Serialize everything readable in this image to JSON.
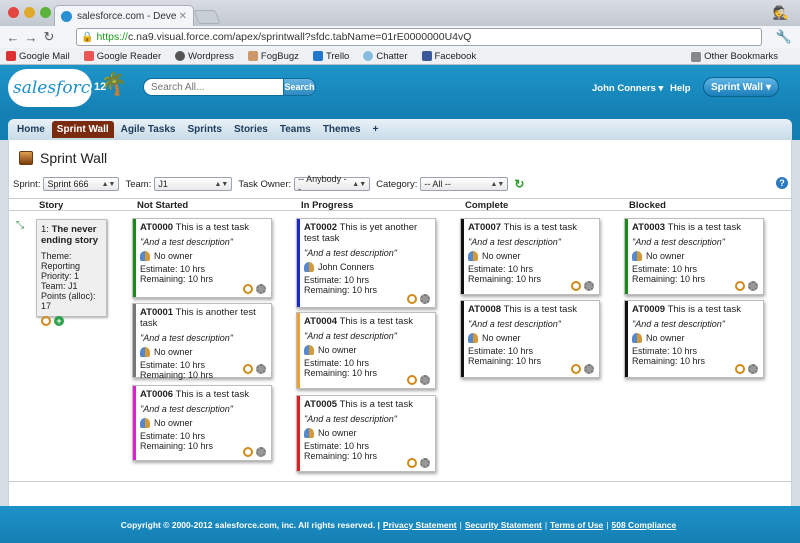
{
  "browser": {
    "tab_title": "salesforce.com - Developer E",
    "url_https": "https://",
    "url_rest": "c.na9.visual.force.com/apex/sprintwall?sfdc.tabName=01rE0000000U4vQ",
    "bookmarks": [
      "Google Mail",
      "Google Reader",
      "Wordpress",
      "FogBugz",
      "Trello",
      "Chatter",
      "Facebook"
    ],
    "other_bookmarks": "Other Bookmarks"
  },
  "header": {
    "logo_text": "salesforce",
    "logo_version": "12",
    "search_placeholder": "Search All...",
    "search_button": "Search",
    "user_name": "John Conners",
    "help": "Help",
    "app_selector": "Sprint Wall"
  },
  "nav_tabs": [
    "Home",
    "Sprint Wall",
    "Agile Tasks",
    "Sprints",
    "Stories",
    "Teams",
    "Themes",
    "+"
  ],
  "page": {
    "title": "Sprint Wall",
    "filters": {
      "sprint_label": "Sprint:",
      "sprint_value": "Sprint 666",
      "team_label": "Team:",
      "team_value": "J1",
      "owner_label": "Task Owner:",
      "owner_value": "-- Anybody --",
      "category_label": "Category:",
      "category_value": "-- All --"
    },
    "columns": [
      "Story",
      "Not Started",
      "In Progress",
      "Complete",
      "Blocked"
    ]
  },
  "story": {
    "number": "1:",
    "title": "The never ending story",
    "theme": "Theme: Reporting",
    "priority": "Priority: 1",
    "team": "Team: J1",
    "points": "Points (alloc): 17"
  },
  "cards": [
    {
      "id": "AT0000",
      "title": "This is a test task",
      "desc": "\"And a test description\"",
      "owner": "No owner",
      "estimate": "Estimate: 10 hrs",
      "remaining": "Remaining: 10 hrs",
      "color": "#1a8a1a"
    },
    {
      "id": "AT0001",
      "title": "This is another test task",
      "desc": "\"And a test description\"",
      "owner": "No owner",
      "estimate": "Estimate: 10 hrs",
      "remaining": "Remaining: 10 hrs",
      "color": "#777777"
    },
    {
      "id": "AT0006",
      "title": "This is a test task",
      "desc": "\"And a test description\"",
      "owner": "No owner",
      "estimate": "Estimate: 10 hrs",
      "remaining": "Remaining: 10 hrs",
      "color": "#e020d0"
    },
    {
      "id": "AT0002",
      "title": "This is yet another test task",
      "desc": "\"And a test description\"",
      "owner": "John Conners",
      "estimate": "Estimate: 10 hrs",
      "remaining": "Remaining: 10 hrs",
      "color": "#1a2acc"
    },
    {
      "id": "AT0004",
      "title": "This is a test task",
      "desc": "\"And a test description\"",
      "owner": "No owner",
      "estimate": "Estimate: 10 hrs",
      "remaining": "Remaining: 10 hrs",
      "color": "#f0a030"
    },
    {
      "id": "AT0005",
      "title": "This is a test task",
      "desc": "\"And a test description\"",
      "owner": "No owner",
      "estimate": "Estimate: 10 hrs",
      "remaining": "Remaining: 10 hrs",
      "color": "#e02020"
    },
    {
      "id": "AT0007",
      "title": "This is a test task",
      "desc": "\"And a test description\"",
      "owner": "No owner",
      "estimate": "Estimate: 10 hrs",
      "remaining": "Remaining: 10 hrs",
      "color": "#111111"
    },
    {
      "id": "AT0008",
      "title": "This is a test task",
      "desc": "\"And a test description\"",
      "owner": "No owner",
      "estimate": "Estimate: 10 hrs",
      "remaining": "Remaining: 10 hrs",
      "color": "#111111"
    },
    {
      "id": "AT0003",
      "title": "This is a test task",
      "desc": "\"And a test description\"",
      "owner": "No owner",
      "estimate": "Estimate: 10 hrs",
      "remaining": "Remaining: 10 hrs",
      "color": "#1a8a1a"
    },
    {
      "id": "AT0009",
      "title": "This is a test task",
      "desc": "\"And a test description\"",
      "owner": "No owner",
      "estimate": "Estimate: 10 hrs",
      "remaining": "Remaining: 10 hrs",
      "color": "#111111"
    }
  ],
  "footer": {
    "copyright": "Copyright © 2000-2012 salesforce.com, inc. All rights reserved. |",
    "links": [
      "Privacy Statement",
      "Security Statement",
      "Terms of Use",
      "508 Compliance"
    ]
  }
}
